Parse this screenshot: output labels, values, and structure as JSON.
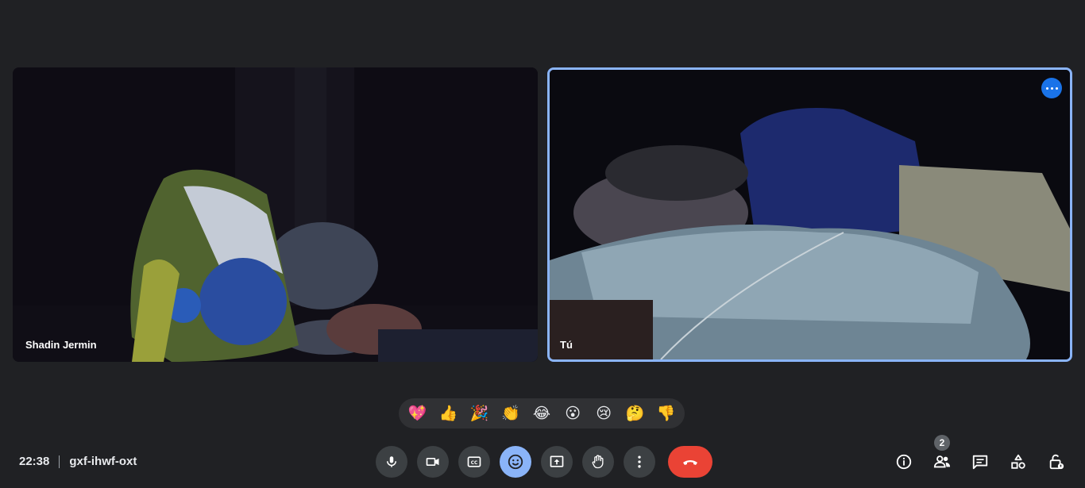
{
  "participants": [
    {
      "name": "Shadin Jermin"
    },
    {
      "name": "Tú"
    }
  ],
  "reactions": [
    "💖",
    "👍",
    "🎉",
    "👏",
    "😂",
    "😮",
    "😢",
    "🤔",
    "👎"
  ],
  "meeting": {
    "time": "22:38",
    "code": "gxf-ihwf-oxt"
  },
  "controls": {
    "icons": [
      "microphone-icon",
      "camera-icon",
      "captions-icon",
      "emoji-icon",
      "present-screen-icon",
      "raise-hand-icon",
      "more-options-icon",
      "end-call-icon"
    ],
    "accent": "#8ab4f8",
    "end_call_color": "#ea4335"
  },
  "side_panel": {
    "participant_count": "2",
    "icons": [
      "info-icon",
      "people-icon",
      "chat-icon",
      "activities-icon",
      "host-controls-icon"
    ]
  }
}
